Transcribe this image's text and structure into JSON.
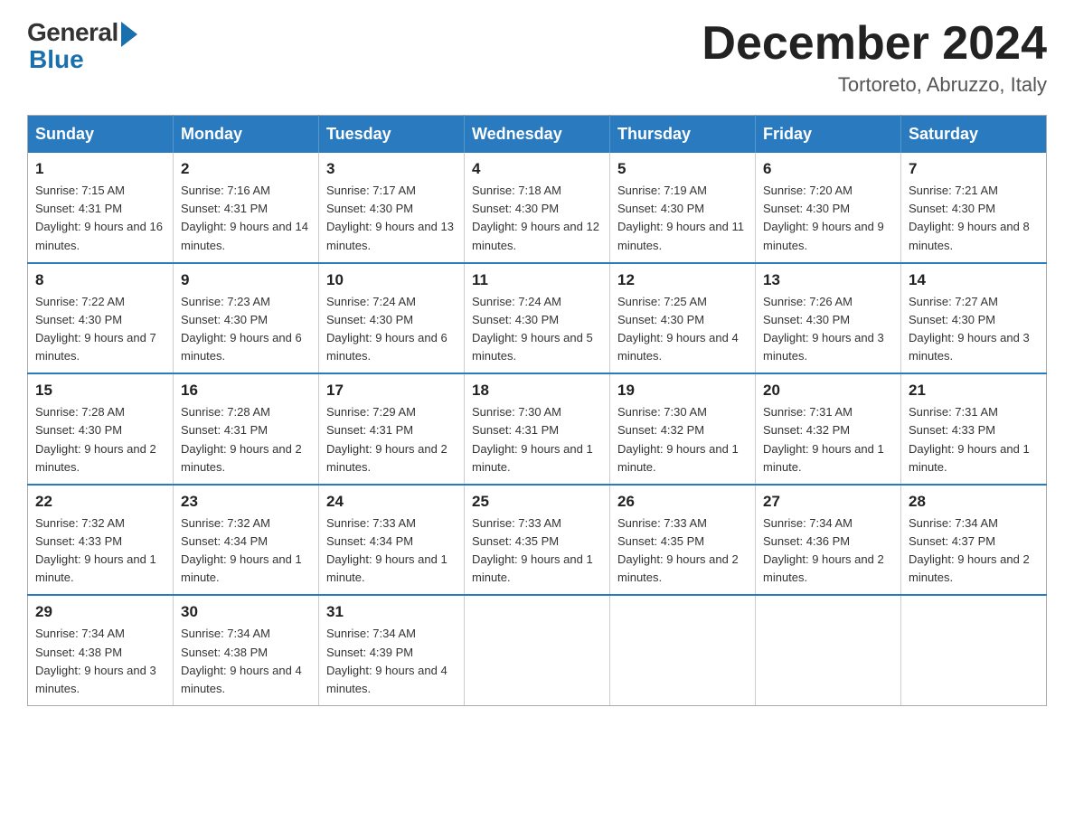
{
  "header": {
    "logo_general": "General",
    "logo_blue": "Blue",
    "month_title": "December 2024",
    "location": "Tortoreto, Abruzzo, Italy"
  },
  "days_of_week": [
    "Sunday",
    "Monday",
    "Tuesday",
    "Wednesday",
    "Thursday",
    "Friday",
    "Saturday"
  ],
  "weeks": [
    [
      {
        "day": "1",
        "sunrise": "7:15 AM",
        "sunset": "4:31 PM",
        "daylight": "9 hours and 16 minutes."
      },
      {
        "day": "2",
        "sunrise": "7:16 AM",
        "sunset": "4:31 PM",
        "daylight": "9 hours and 14 minutes."
      },
      {
        "day": "3",
        "sunrise": "7:17 AM",
        "sunset": "4:30 PM",
        "daylight": "9 hours and 13 minutes."
      },
      {
        "day": "4",
        "sunrise": "7:18 AM",
        "sunset": "4:30 PM",
        "daylight": "9 hours and 12 minutes."
      },
      {
        "day": "5",
        "sunrise": "7:19 AM",
        "sunset": "4:30 PM",
        "daylight": "9 hours and 11 minutes."
      },
      {
        "day": "6",
        "sunrise": "7:20 AM",
        "sunset": "4:30 PM",
        "daylight": "9 hours and 9 minutes."
      },
      {
        "day": "7",
        "sunrise": "7:21 AM",
        "sunset": "4:30 PM",
        "daylight": "9 hours and 8 minutes."
      }
    ],
    [
      {
        "day": "8",
        "sunrise": "7:22 AM",
        "sunset": "4:30 PM",
        "daylight": "9 hours and 7 minutes."
      },
      {
        "day": "9",
        "sunrise": "7:23 AM",
        "sunset": "4:30 PM",
        "daylight": "9 hours and 6 minutes."
      },
      {
        "day": "10",
        "sunrise": "7:24 AM",
        "sunset": "4:30 PM",
        "daylight": "9 hours and 6 minutes."
      },
      {
        "day": "11",
        "sunrise": "7:24 AM",
        "sunset": "4:30 PM",
        "daylight": "9 hours and 5 minutes."
      },
      {
        "day": "12",
        "sunrise": "7:25 AM",
        "sunset": "4:30 PM",
        "daylight": "9 hours and 4 minutes."
      },
      {
        "day": "13",
        "sunrise": "7:26 AM",
        "sunset": "4:30 PM",
        "daylight": "9 hours and 3 minutes."
      },
      {
        "day": "14",
        "sunrise": "7:27 AM",
        "sunset": "4:30 PM",
        "daylight": "9 hours and 3 minutes."
      }
    ],
    [
      {
        "day": "15",
        "sunrise": "7:28 AM",
        "sunset": "4:30 PM",
        "daylight": "9 hours and 2 minutes."
      },
      {
        "day": "16",
        "sunrise": "7:28 AM",
        "sunset": "4:31 PM",
        "daylight": "9 hours and 2 minutes."
      },
      {
        "day": "17",
        "sunrise": "7:29 AM",
        "sunset": "4:31 PM",
        "daylight": "9 hours and 2 minutes."
      },
      {
        "day": "18",
        "sunrise": "7:30 AM",
        "sunset": "4:31 PM",
        "daylight": "9 hours and 1 minute."
      },
      {
        "day": "19",
        "sunrise": "7:30 AM",
        "sunset": "4:32 PM",
        "daylight": "9 hours and 1 minute."
      },
      {
        "day": "20",
        "sunrise": "7:31 AM",
        "sunset": "4:32 PM",
        "daylight": "9 hours and 1 minute."
      },
      {
        "day": "21",
        "sunrise": "7:31 AM",
        "sunset": "4:33 PM",
        "daylight": "9 hours and 1 minute."
      }
    ],
    [
      {
        "day": "22",
        "sunrise": "7:32 AM",
        "sunset": "4:33 PM",
        "daylight": "9 hours and 1 minute."
      },
      {
        "day": "23",
        "sunrise": "7:32 AM",
        "sunset": "4:34 PM",
        "daylight": "9 hours and 1 minute."
      },
      {
        "day": "24",
        "sunrise": "7:33 AM",
        "sunset": "4:34 PM",
        "daylight": "9 hours and 1 minute."
      },
      {
        "day": "25",
        "sunrise": "7:33 AM",
        "sunset": "4:35 PM",
        "daylight": "9 hours and 1 minute."
      },
      {
        "day": "26",
        "sunrise": "7:33 AM",
        "sunset": "4:35 PM",
        "daylight": "9 hours and 2 minutes."
      },
      {
        "day": "27",
        "sunrise": "7:34 AM",
        "sunset": "4:36 PM",
        "daylight": "9 hours and 2 minutes."
      },
      {
        "day": "28",
        "sunrise": "7:34 AM",
        "sunset": "4:37 PM",
        "daylight": "9 hours and 2 minutes."
      }
    ],
    [
      {
        "day": "29",
        "sunrise": "7:34 AM",
        "sunset": "4:38 PM",
        "daylight": "9 hours and 3 minutes."
      },
      {
        "day": "30",
        "sunrise": "7:34 AM",
        "sunset": "4:38 PM",
        "daylight": "9 hours and 4 minutes."
      },
      {
        "day": "31",
        "sunrise": "7:34 AM",
        "sunset": "4:39 PM",
        "daylight": "9 hours and 4 minutes."
      },
      null,
      null,
      null,
      null
    ]
  ]
}
